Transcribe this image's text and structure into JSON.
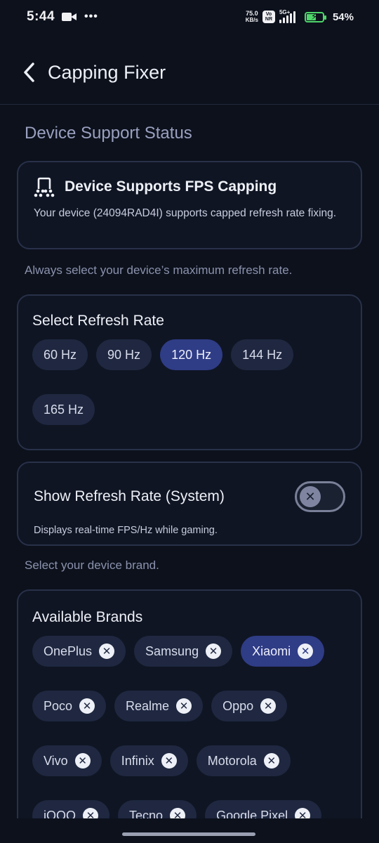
{
  "status_bar": {
    "time": "5:44",
    "net_speed_value": "75.0",
    "net_speed_unit": "KB/s",
    "vonr_top": "Vo",
    "vonr_bottom": "NR",
    "network": "5G+",
    "battery_pct": "54%"
  },
  "header": {
    "title": "Capping Fixer"
  },
  "section_title": "Device Support Status",
  "support": {
    "title": "Device Supports FPS Capping",
    "description": "Your device (24094RAD4I) supports capped refresh rate fixing."
  },
  "rate_hint": "Always select your device’s maximum refresh rate.",
  "refresh": {
    "title": "Select Refresh Rate",
    "options": [
      {
        "label": "60 Hz",
        "selected": false
      },
      {
        "label": "90 Hz",
        "selected": false
      },
      {
        "label": "120 Hz",
        "selected": true
      },
      {
        "label": "144 Hz",
        "selected": false
      },
      {
        "label": "165 Hz",
        "selected": false
      }
    ]
  },
  "toggle": {
    "title": "Show Refresh Rate (System)",
    "description": "Displays real-time FPS/Hz while gaming.",
    "enabled": false
  },
  "brand_hint": "Select your device brand.",
  "brands": {
    "title": "Available Brands",
    "items": [
      {
        "label": "OnePlus",
        "selected": false
      },
      {
        "label": "Samsung",
        "selected": false
      },
      {
        "label": "Xiaomi",
        "selected": true
      },
      {
        "label": "Poco",
        "selected": false
      },
      {
        "label": "Realme",
        "selected": false
      },
      {
        "label": "Oppo",
        "selected": false
      },
      {
        "label": "Vivo",
        "selected": false
      },
      {
        "label": "Infinix",
        "selected": false
      },
      {
        "label": "Motorola",
        "selected": false
      },
      {
        "label": "iQOO",
        "selected": false
      },
      {
        "label": "Tecno",
        "selected": false
      },
      {
        "label": "Google Pixel",
        "selected": false
      }
    ]
  },
  "colors": {
    "background": "#0c111c",
    "chip": "#1f2840",
    "chip_selected": "#2f3c86",
    "card_border": "#283149"
  }
}
